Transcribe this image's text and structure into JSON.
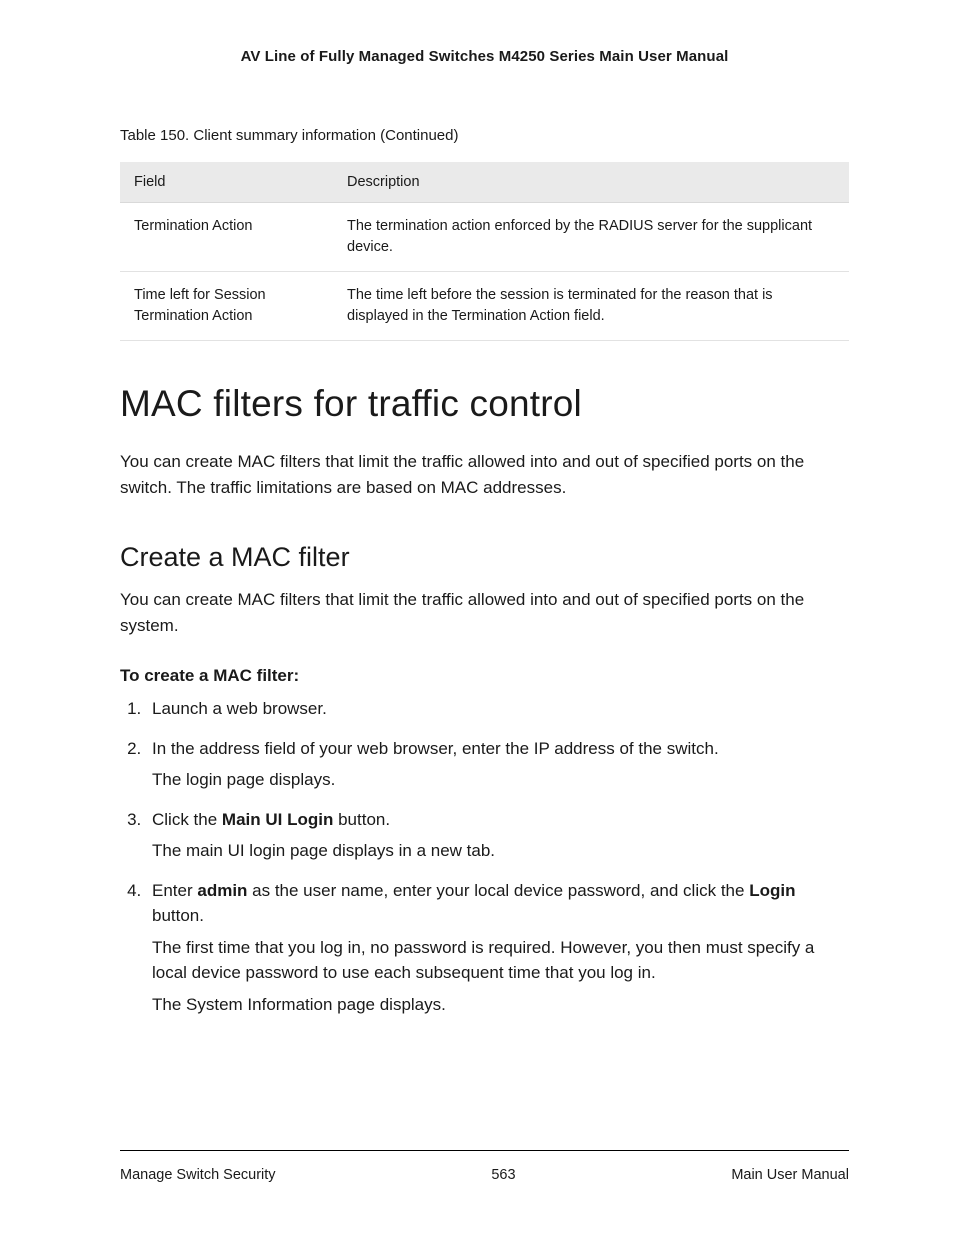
{
  "header": {
    "title": "AV Line of Fully Managed Switches M4250 Series Main User Manual"
  },
  "table": {
    "caption": "Table 150. Client summary information (Continued)",
    "head": {
      "field": "Field",
      "description": "Description"
    },
    "rows": [
      {
        "field": "Termination Action",
        "description": "The termination action enforced by the RADIUS server for the supplicant device."
      },
      {
        "field": "Time left for Session Termination Action",
        "description": "The time left before the session is terminated for the reason that is displayed in the Termination Action field."
      }
    ]
  },
  "section": {
    "title": "MAC filters for traffic control",
    "intro": "You can create MAC filters that limit the traffic allowed into and out of specified ports on the switch. The traffic limitations are based on MAC addresses."
  },
  "subsection": {
    "title": "Create a MAC filter",
    "intro": "You can create MAC filters that limit the traffic allowed into and out of specified ports on the system.",
    "procedure_title": "To create a MAC filter:",
    "steps": {
      "s1": "Launch a web browser.",
      "s2a": "In the address field of your web browser, enter the IP address of the switch.",
      "s2b": "The login page displays.",
      "s3a_pre": "Click the ",
      "s3a_bold": "Main UI Login",
      "s3a_post": " button.",
      "s3b": "The main UI login page displays in a new tab.",
      "s4a_pre": "Enter ",
      "s4a_bold1": "admin",
      "s4a_mid": " as the user name, enter your local device password, and click the ",
      "s4a_bold2": "Login",
      "s4a_post": " button.",
      "s4b": "The first time that you log in, no password is required. However, you then must specify a local device password to use each subsequent time that you log in.",
      "s4c": "The System Information page displays."
    }
  },
  "footer": {
    "left": "Manage Switch Security",
    "center": "563",
    "right": "Main User Manual"
  }
}
